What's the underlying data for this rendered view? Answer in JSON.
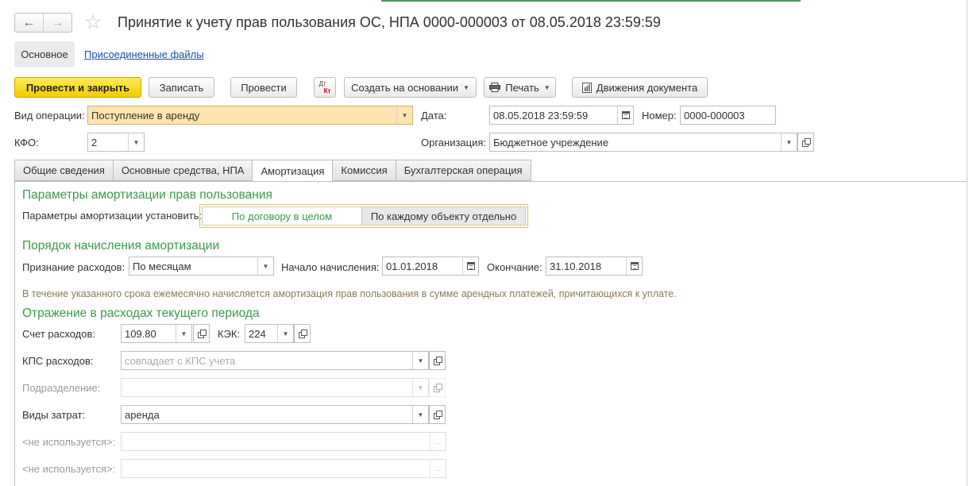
{
  "window": {
    "title": "Принятие к учету прав пользования ОС, НПА 0000-000003 от 08.05.2018 23:59:59",
    "back_icon": "←",
    "forward_icon": "→",
    "star_icon": "☆"
  },
  "form_tabs": {
    "main": "Основное",
    "attached": "Присоединенные файлы"
  },
  "toolbar": {
    "post_close": "Провести и закрыть",
    "save": "Записать",
    "post": "Провести",
    "dt_kt_top": "Дт",
    "dt_kt_bottom": "Кт",
    "create_based": "Создать на основании",
    "print": "Печать",
    "movements": "Движения документа",
    "caret": "▼"
  },
  "header": {
    "operation_label": "Вид операции:",
    "operation_value": "Поступление в аренду",
    "date_label": "Дата:",
    "date_value": "08.05.2018 23:59:59",
    "number_label": "Номер:",
    "number_value": "0000-000003",
    "kfo_label": "КФО:",
    "kfo_value": "2",
    "org_label": "Организация:",
    "org_value": "Бюджетное учреждение"
  },
  "tabs": [
    "Общие сведения",
    "Основные средства, НПА",
    "Амортизация",
    "Комиссия",
    "Бухгалтерская операция"
  ],
  "amortization": {
    "params_title": "Параметры амортизации прав пользования",
    "params_label": "Параметры амортизации установить:",
    "opt_contract": "По договору в целом",
    "opt_each": "По каждому объекту отдельно",
    "order_title": "Порядок начисления амортизации",
    "recognition_label": "Признание расходов:",
    "recognition_value": "По месяцам",
    "start_label": "Начало начисления:",
    "start_value": "01.01.2018",
    "end_label": "Окончание:",
    "end_value": "31.10.2018",
    "note": "В течение указанного срока ежемесячно начисляется амортизация прав пользования в сумме арендных платежей, причитающихся к уплате."
  },
  "expenses": {
    "title": "Отражение в расходах текущего периода",
    "account_label": "Счет расходов:",
    "account_value": "109.80",
    "kek_label": "КЭК:",
    "kek_value": "224",
    "kps_label": "КПС расходов:",
    "kps_placeholder": "совпадает с КПС учета",
    "dept_label": "Подразделение:",
    "cost_type_label": "Виды затрат:",
    "cost_type_value": "аренда",
    "unused1_label": "<не используется>:",
    "unused2_label": "<не используется>:",
    "dots": "..."
  }
}
